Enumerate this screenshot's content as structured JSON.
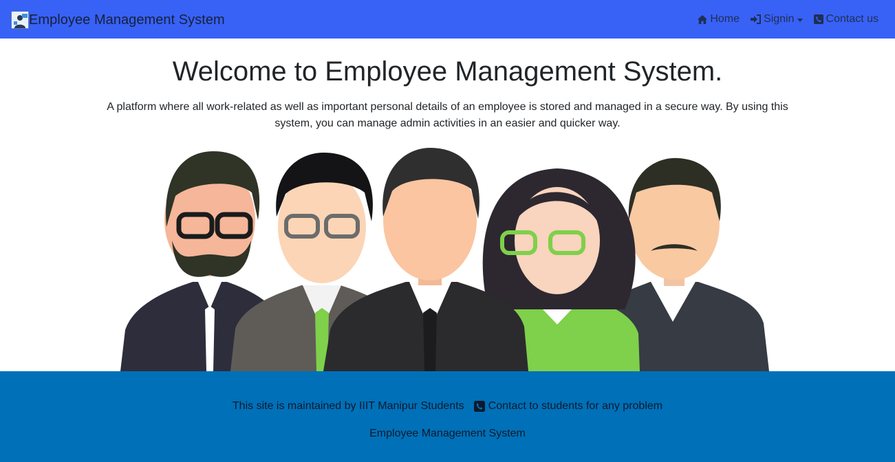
{
  "navbar": {
    "brand": "Employee Management System",
    "items": [
      {
        "label": "Home",
        "icon": "home-icon"
      },
      {
        "label": "Signin",
        "icon": "sign-in-icon"
      },
      {
        "label": "Contact us",
        "icon": "phone-icon"
      }
    ]
  },
  "hero": {
    "title": "Welcome to Employee Management System.",
    "lead": "A platform where all work-related as well as important personal details of an employee is stored and managed in a secure way. By using this system, you can manage admin activities in an easier and quicker way."
  },
  "footer": {
    "maintained": "This site is maintained by IIIT Manipur Students",
    "contact": "Contact to students for any problem",
    "name": "Employee Management System"
  },
  "colors": {
    "navbar": "#3861f6",
    "footer": "#0070b8"
  }
}
